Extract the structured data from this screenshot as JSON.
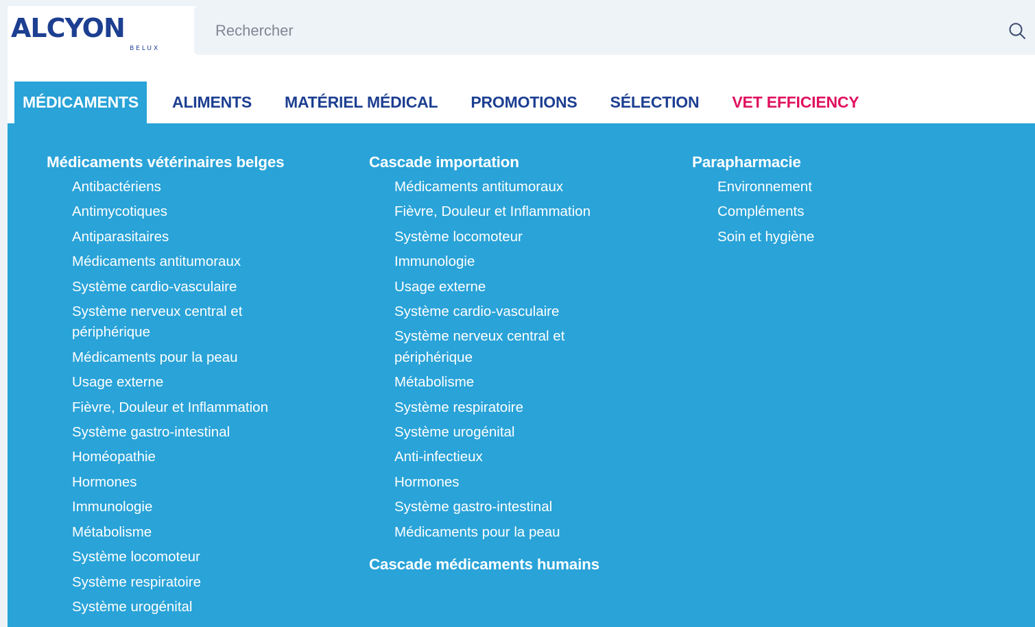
{
  "logo": {
    "word": "ALCYON",
    "sub": "BELUX"
  },
  "search": {
    "placeholder": "Rechercher"
  },
  "nav": [
    {
      "label": "MÉDICAMENTS"
    },
    {
      "label": "ALIMENTS"
    },
    {
      "label": "MATÉRIEL MÉDICAL"
    },
    {
      "label": "PROMOTIONS"
    },
    {
      "label": "SÉLECTION"
    },
    {
      "label": "VET EFFICIENCY"
    }
  ],
  "colors": {
    "brand": "#1d3f91",
    "menu_bg": "#29a3d8",
    "accent": "#e0115f"
  },
  "menu": {
    "columns": [
      {
        "groups": [
          {
            "title": "Médicaments vétérinaires belges",
            "items": [
              "Antibactériens",
              "Antimycotiques",
              "Antiparasitaires",
              "Médicaments antitumoraux",
              "Système cardio-vasculaire",
              "Système nerveux central et périphérique",
              "Médicaments pour la peau",
              "Usage externe",
              "Fièvre, Douleur et Inflammation",
              "Système gastro-intestinal",
              "Homéopathie",
              "Hormones",
              "Immunologie",
              "Métabolisme",
              "Système locomoteur",
              "Système respiratoire",
              "Système urogénital"
            ]
          }
        ]
      },
      {
        "groups": [
          {
            "title": "Cascade importation",
            "items": [
              "Médicaments antitumoraux",
              "Fièvre, Douleur et Inflammation",
              "Système locomoteur",
              "Immunologie",
              "Usage externe",
              "Système cardio-vasculaire",
              "Système nerveux central et périphérique",
              "Métabolisme",
              "Système respiratoire",
              "Système urogénital",
              "Anti-infectieux",
              "Hormones",
              "Système gastro-intestinal",
              "Médicaments pour la peau"
            ]
          },
          {
            "title": "Cascade médicaments humains",
            "items": []
          }
        ]
      },
      {
        "groups": [
          {
            "title": "Parapharmacie",
            "items": [
              "Environnement",
              "Compléments",
              "Soin et hygiène"
            ]
          }
        ]
      }
    ]
  }
}
